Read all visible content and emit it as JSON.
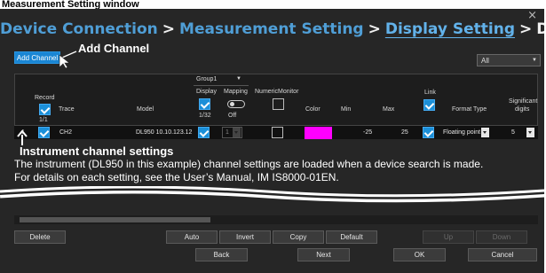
{
  "caption": "Measurement Setting window",
  "window": {
    "close_glyph": "×"
  },
  "steps": [
    "Device Connection",
    "Measurement Setting",
    "Display Setting",
    "DAQ Setting"
  ],
  "step_separator": ">",
  "buttons": {
    "add_channel": "Add Channel",
    "delete": "Delete",
    "auto": "Auto",
    "invert": "Invert",
    "copy": "Copy",
    "default": "Default",
    "up": "Up",
    "down": "Down",
    "back": "Back",
    "next": "Next",
    "ok": "OK",
    "cancel": "Cancel"
  },
  "callouts": {
    "add_channel": "Add Channel"
  },
  "filter": {
    "value": "All"
  },
  "table": {
    "group_label": "Group1",
    "headers": {
      "record": "Record",
      "record_count": "1/1",
      "trace": "Trace",
      "model": "Model",
      "display": "Display",
      "display_count": "1/32",
      "mapping": "Mapping",
      "mapping_state": "Off",
      "numeric_monitor": "NumericMonitor",
      "color": "Color",
      "min": "Min",
      "max": "Max",
      "link": "Link",
      "format_type": "Format Type",
      "significant": "Significant",
      "digits": "digits"
    },
    "row": {
      "index": "1",
      "trace": "CH2",
      "model": "DL950 10.10.123.12",
      "mapping": "1",
      "color": "#ff00ff",
      "min": "-25",
      "max": "25",
      "format_type": "Floating point",
      "digits": "5"
    }
  },
  "info": {
    "title": "Instrument channel settings",
    "line1": "The instrument (DL950 in this example) channel settings are loaded when a device search is made.",
    "line2": "For details on each setting, see the User’s Manual, IM IS8000-01EN."
  },
  "colors": {
    "accent": "#1a86d4",
    "step_link": "#4f9ed6",
    "window_bg": "#262626",
    "trace_color": "#ff00ff"
  },
  "icons": [
    "close-icon",
    "checkbox-icon",
    "dropdown-icon",
    "toggle-icon",
    "arrow-icon"
  ]
}
